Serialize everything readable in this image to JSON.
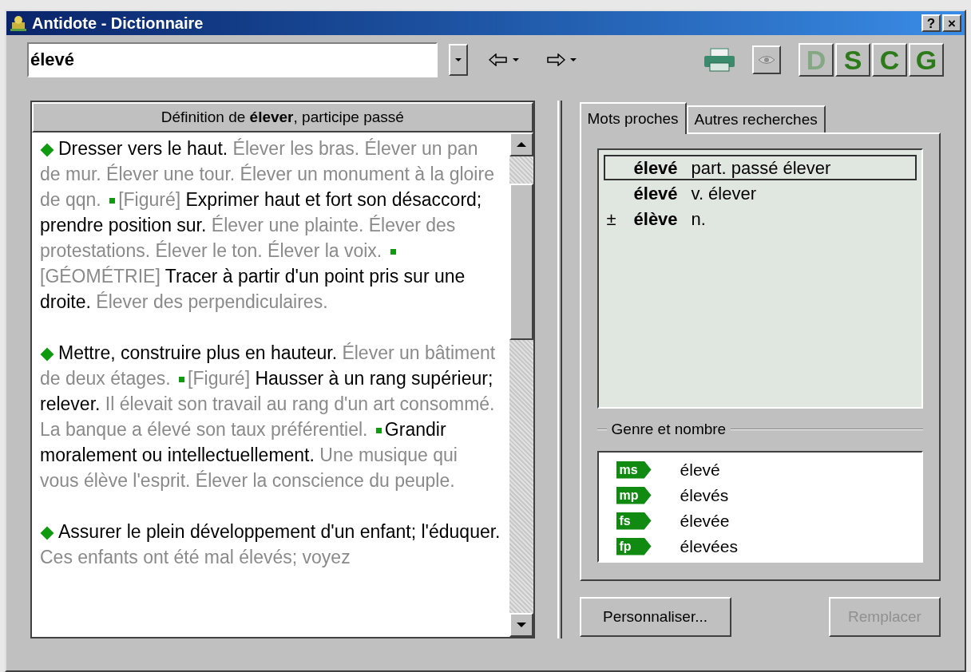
{
  "window": {
    "title": "Antidote - Dictionnaire",
    "controls": [
      "?",
      "×"
    ]
  },
  "search": {
    "value": "élevé"
  },
  "modes": [
    {
      "label": "D",
      "disabled": true
    },
    {
      "label": "S",
      "disabled": false
    },
    {
      "label": "C",
      "disabled": false
    },
    {
      "label": "G",
      "disabled": false
    }
  ],
  "definition": {
    "heading": "Définition de **élever**, participe passé",
    "paragraphs": [
      [
        {
          "kind": "def",
          "text": "Dresser vers le haut."
        },
        {
          "kind": "ex",
          "text": "Élever les bras. Élever un pan de mur. Élever une tour. Élever un monument à la gloire de qqn."
        },
        {
          "kind": "bullet"
        },
        {
          "kind": "ex",
          "text": "[Figuré]"
        },
        {
          "kind": "def",
          "text": "Exprimer haut et fort son désaccord; prendre position sur."
        },
        {
          "kind": "ex",
          "text": "Élever une plainte. Élever des protestations. Élever le ton. Élever la voix."
        },
        {
          "kind": "bullet"
        },
        {
          "kind": "ex",
          "text": "[GÉOMÉTRIE]"
        },
        {
          "kind": "def",
          "text": "Tracer à partir d'un point pris sur une droite."
        },
        {
          "kind": "ex",
          "text": "Élever des perpendiculaires."
        }
      ],
      [
        {
          "kind": "def",
          "text": "Mettre, construire plus en hauteur."
        },
        {
          "kind": "ex",
          "text": "Élever un bâtiment de deux étages."
        },
        {
          "kind": "bullet"
        },
        {
          "kind": "ex",
          "text": "[Figuré]"
        },
        {
          "kind": "def",
          "text": "Hausser à un rang supérieur; relever."
        },
        {
          "kind": "ex",
          "text": "Il élevait son travail au rang d'un art consommé. La banque a élevé son taux préférentiel."
        },
        {
          "kind": "bullet"
        },
        {
          "kind": "def",
          "text": "Grandir moralement ou intellectuellement."
        },
        {
          "kind": "ex",
          "text": "Une musique qui vous élève l'esprit. Élever la conscience du peuple."
        }
      ],
      [
        {
          "kind": "def",
          "text": "Assurer le plein développement d'un enfant; l'éduquer."
        },
        {
          "kind": "ex",
          "text": "Ces enfants ont été mal élevés; voyez"
        }
      ]
    ]
  },
  "tabs": [
    {
      "label": "Mots proches",
      "selected": true
    },
    {
      "label": "Autres recherches",
      "selected": false
    }
  ],
  "near_words": [
    {
      "word": "élevé",
      "info": "part. passé élever",
      "selected": true
    },
    {
      "word": "élevé",
      "info": "v. élever",
      "selected": false
    },
    {
      "mark": "±",
      "word": "élève",
      "info": "n.",
      "selected": false
    }
  ],
  "forms": {
    "legend": "Genre et nombre",
    "items": [
      {
        "tag": "ms",
        "word": "élevé"
      },
      {
        "tag": "mp",
        "word": "élevés"
      },
      {
        "tag": "fs",
        "word": "élevée"
      },
      {
        "tag": "fp",
        "word": "élevées"
      }
    ]
  },
  "buttons": [
    {
      "label": "Personnaliser...",
      "disabled": false
    },
    {
      "label": "Remplacer",
      "disabled": true
    }
  ]
}
